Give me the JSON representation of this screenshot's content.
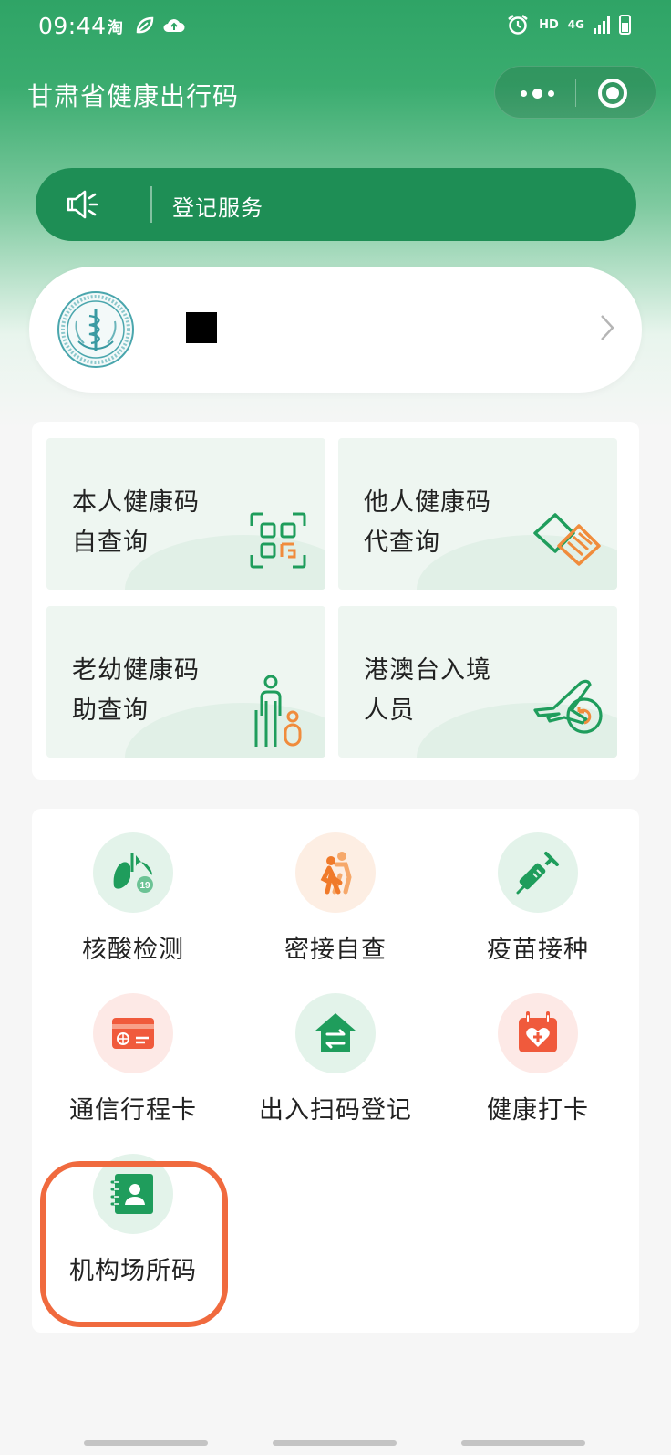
{
  "status_bar": {
    "time": "09:44",
    "left_icons": [
      "taobao-icon",
      "leaf-app-icon",
      "cloud-upload-icon"
    ],
    "hd": "HD",
    "network": "4G",
    "right_icons": [
      "alarm-icon",
      "signal-icon",
      "battery-icon"
    ]
  },
  "header": {
    "title": "甘肃省健康出行码",
    "capsule_icons": [
      "more-dots-icon",
      "close-target-icon"
    ]
  },
  "notice": {
    "icon": "speaker-icon",
    "text": "登记服务"
  },
  "user_card": {
    "emblem": "health-commission-emblem",
    "name": "■",
    "chevron": "chevron-right-icon"
  },
  "tiles": [
    {
      "line1": "本人健康码",
      "line2": "自查询",
      "icon": "qr-scan-icon"
    },
    {
      "line1": "他人健康码",
      "line2": "代查询",
      "icon": "handshake-icon"
    },
    {
      "line1": "老幼健康码",
      "line2": "助查询",
      "icon": "elder-child-icon"
    },
    {
      "line1": "港澳台入境",
      "line2": "人员",
      "icon": "airplane-arrival-icon"
    }
  ],
  "services": [
    {
      "label": "核酸检测",
      "icon": "lungs-virus-icon"
    },
    {
      "label": "密接自查",
      "icon": "walking-people-icon"
    },
    {
      "label": "疫苗接种",
      "icon": "syringe-icon"
    },
    {
      "label": "通信行程卡",
      "icon": "travel-card-icon"
    },
    {
      "label": "出入扫码登记",
      "icon": "home-exchange-icon"
    },
    {
      "label": "健康打卡",
      "icon": "calendar-heart-icon"
    },
    {
      "label": "机构场所码",
      "icon": "contact-book-icon"
    }
  ],
  "colors": {
    "brand_green": "#1e8e55",
    "header_green": "#2fa466",
    "accent_orange": "#f08c3c",
    "highlight_ring": "#f06a3e"
  }
}
